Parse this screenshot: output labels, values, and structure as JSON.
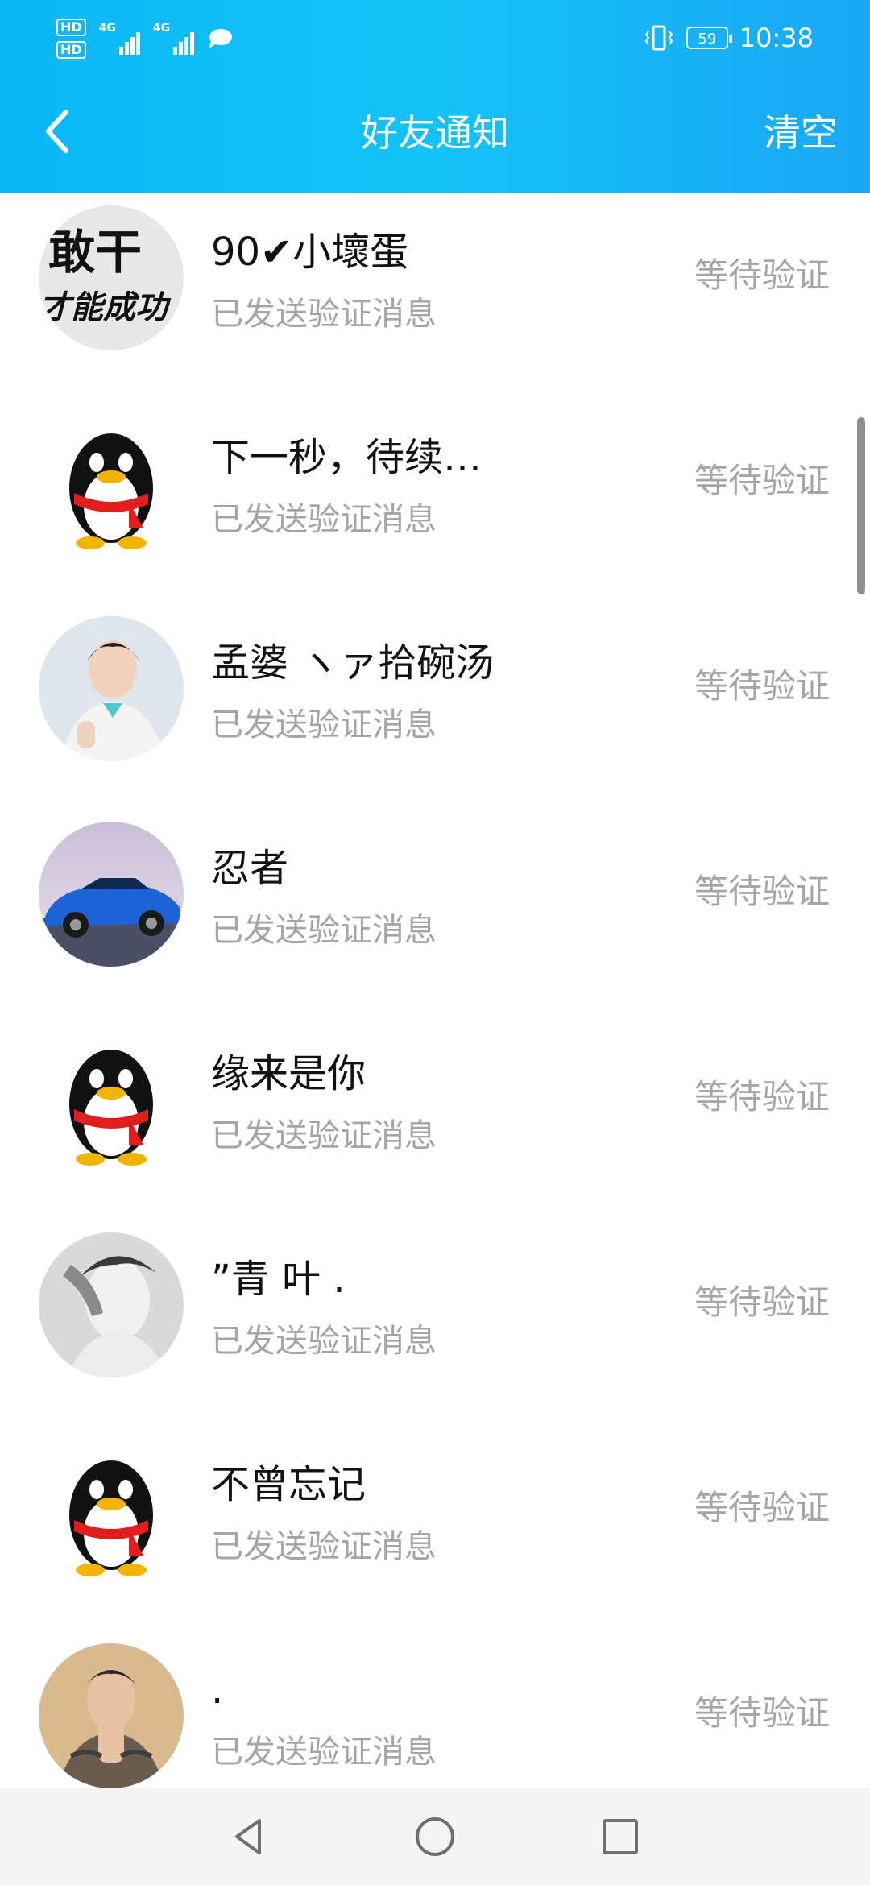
{
  "status_bar": {
    "hd1": "HD",
    "hd2": "HD",
    "net1": "4G",
    "net2": "4G",
    "battery": "59",
    "time": "10:38"
  },
  "header": {
    "title": "好友通知",
    "clear_label": "清空"
  },
  "requests": [
    {
      "name": "90✔小壞蛋",
      "sub": "已发送验证消息",
      "status": "等待验证",
      "avatar": "calligraphy-avatar"
    },
    {
      "name": "下一秒，待续…",
      "sub": "已发送验证消息",
      "status": "等待验证",
      "avatar": "penguin-avatar"
    },
    {
      "name": "孟婆 ヽァ拾碗汤",
      "sub": "已发送验证消息",
      "status": "等待验证",
      "avatar": "portrait-avatar"
    },
    {
      "name": "忍者",
      "sub": "已发送验证消息",
      "status": "等待验证",
      "avatar": "blue-car-avatar"
    },
    {
      "name": "缘来是你",
      "sub": "已发送验证消息",
      "status": "等待验证",
      "avatar": "penguin-avatar"
    },
    {
      "name": "”青 叶 .",
      "sub": "已发送验证消息",
      "status": "等待验证",
      "avatar": "grayscale-portrait-avatar"
    },
    {
      "name": "不曾忘记",
      "sub": "已发送验证消息",
      "status": "等待验证",
      "avatar": "penguin-avatar"
    },
    {
      "name": ".",
      "sub": "已发送验证消息",
      "status": "等待验证",
      "avatar": "tattoo-portrait-avatar"
    }
  ],
  "colors": {
    "header_gradient_start": "#0bb8f6",
    "header_gradient_end": "#1aa7f5",
    "subtext": "#a5a5a5",
    "status_text": "#a6a6a6"
  },
  "icons": {
    "back": "chevron-left-icon",
    "nav_back": "triangle-back-icon",
    "nav_home": "circle-home-icon",
    "nav_recent": "square-recents-icon"
  }
}
